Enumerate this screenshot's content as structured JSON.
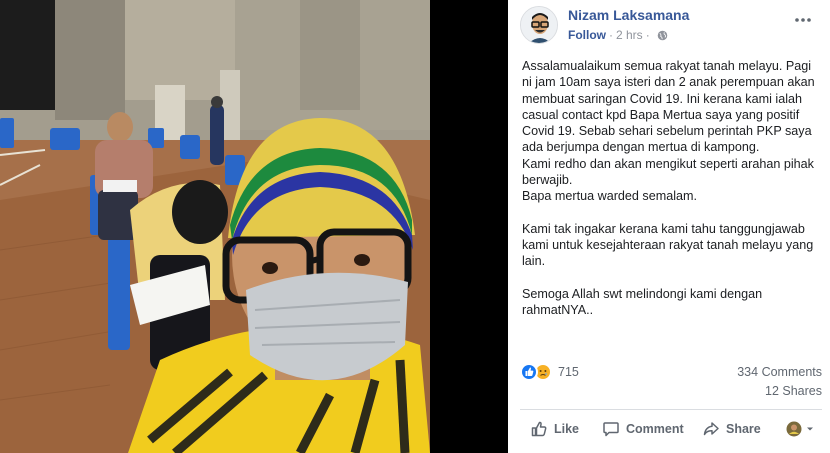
{
  "post": {
    "author": "Nizam Laksamana",
    "follow_label": "Follow",
    "dot": "·",
    "time": "2 hrs",
    "paragraphs": [
      "Assalamualaikum semua rakyat tanah melayu. Pagi ni jam 10am saya isteri dan 2 anak perempuan akan membuat saringan Covid 19. Ini kerana kami ialah casual contact kpd Bapa Mertua saya yang positif Covid 19. Sebab sehari sebelum perintah PKP saya ada berjumpa dengan mertua di kampong.",
      "Kami redho dan akan mengikut seperti arahan pihak berwajib.",
      "Bapa mertua warded semalam.",
      "Kami tak ingakar kerana kami tahu tanggungjawab kami untuk kesejahteraan rakyat tanah melayu yang lain.",
      "Semoga Allah swt melindongi kami dengan rahmatNYA.."
    ]
  },
  "stats": {
    "reaction_count": "715",
    "reaction_icons": [
      "like-icon",
      "sad-icon"
    ],
    "comments": "334 Comments",
    "shares": "12 Shares"
  },
  "actions": {
    "like": "Like",
    "comment": "Comment",
    "share": "Share"
  },
  "colors": {
    "link": "#385898",
    "text": "#1c1e21",
    "muted": "#606770",
    "like_blue": "#1877f2",
    "sad_yellow": "#f7b125"
  }
}
